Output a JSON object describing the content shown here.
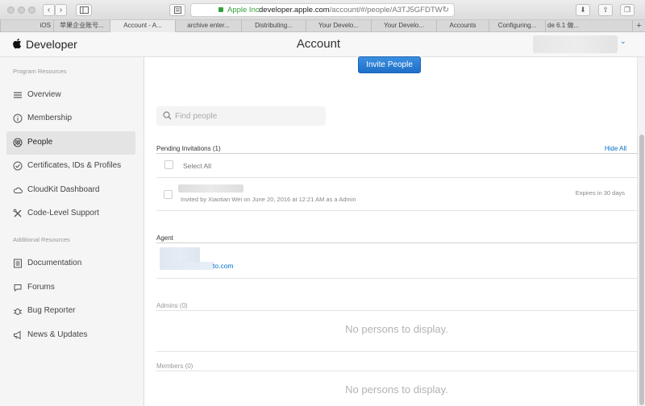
{
  "browser": {
    "url_owner": "Apple Inc.",
    "url_domain": "developer.apple.com",
    "url_path": "/account/#/people/A3TJ5GFDTW",
    "tabs": [
      "iOS",
      "苹果企业账号...",
      "Account - A...",
      "archive enter...",
      "Distributing...",
      "Your Develo...",
      "Your Develo...",
      "Accounts",
      "Configuring...",
      "de 6.1 做..."
    ],
    "new_tab_label": "+"
  },
  "header": {
    "brand": "Developer",
    "title": "Account"
  },
  "sidebar": {
    "program_resources_title": "Program Resources",
    "additional_resources_title": "Additional Resources",
    "items": [
      {
        "label": "Overview",
        "icon": "list-icon"
      },
      {
        "label": "Membership",
        "icon": "info-icon"
      },
      {
        "label": "People",
        "icon": "people-icon",
        "selected": true
      },
      {
        "label": "Certificates, IDs & Profiles",
        "icon": "certificate-icon"
      },
      {
        "label": "CloudKit Dashboard",
        "icon": "cloud-icon"
      },
      {
        "label": "Code-Level Support",
        "icon": "wrench-icon"
      }
    ],
    "additional_items": [
      {
        "label": "Documentation",
        "icon": "documentation-icon"
      },
      {
        "label": "Forums",
        "icon": "forums-icon"
      },
      {
        "label": "Bug Reporter",
        "icon": "bug-icon"
      },
      {
        "label": "News & Updates",
        "icon": "megaphone-icon"
      }
    ]
  },
  "main": {
    "invite_button": "Invite People",
    "search_placeholder": "Find people",
    "pending": {
      "title": "Pending Invitations (1)",
      "hide_all": "Hide All",
      "select_all": "Select All",
      "invitation_detail": "Invited by Xiaotian Wei on June 20, 2016 at 12:21 AM as a Admin",
      "expires": "Expires in 30 days"
    },
    "agent": {
      "title": "Agent",
      "email_suffix": "to.com"
    },
    "admins": {
      "title": "Admins (0)",
      "empty": "No persons to display."
    },
    "members": {
      "title": "Members (0)",
      "empty": "No persons to display."
    }
  },
  "colors": {
    "accent": "#0070c9",
    "button": "#1f6fc8",
    "secure": "#35a13c",
    "sidebar_bg": "#f5f5f5"
  }
}
